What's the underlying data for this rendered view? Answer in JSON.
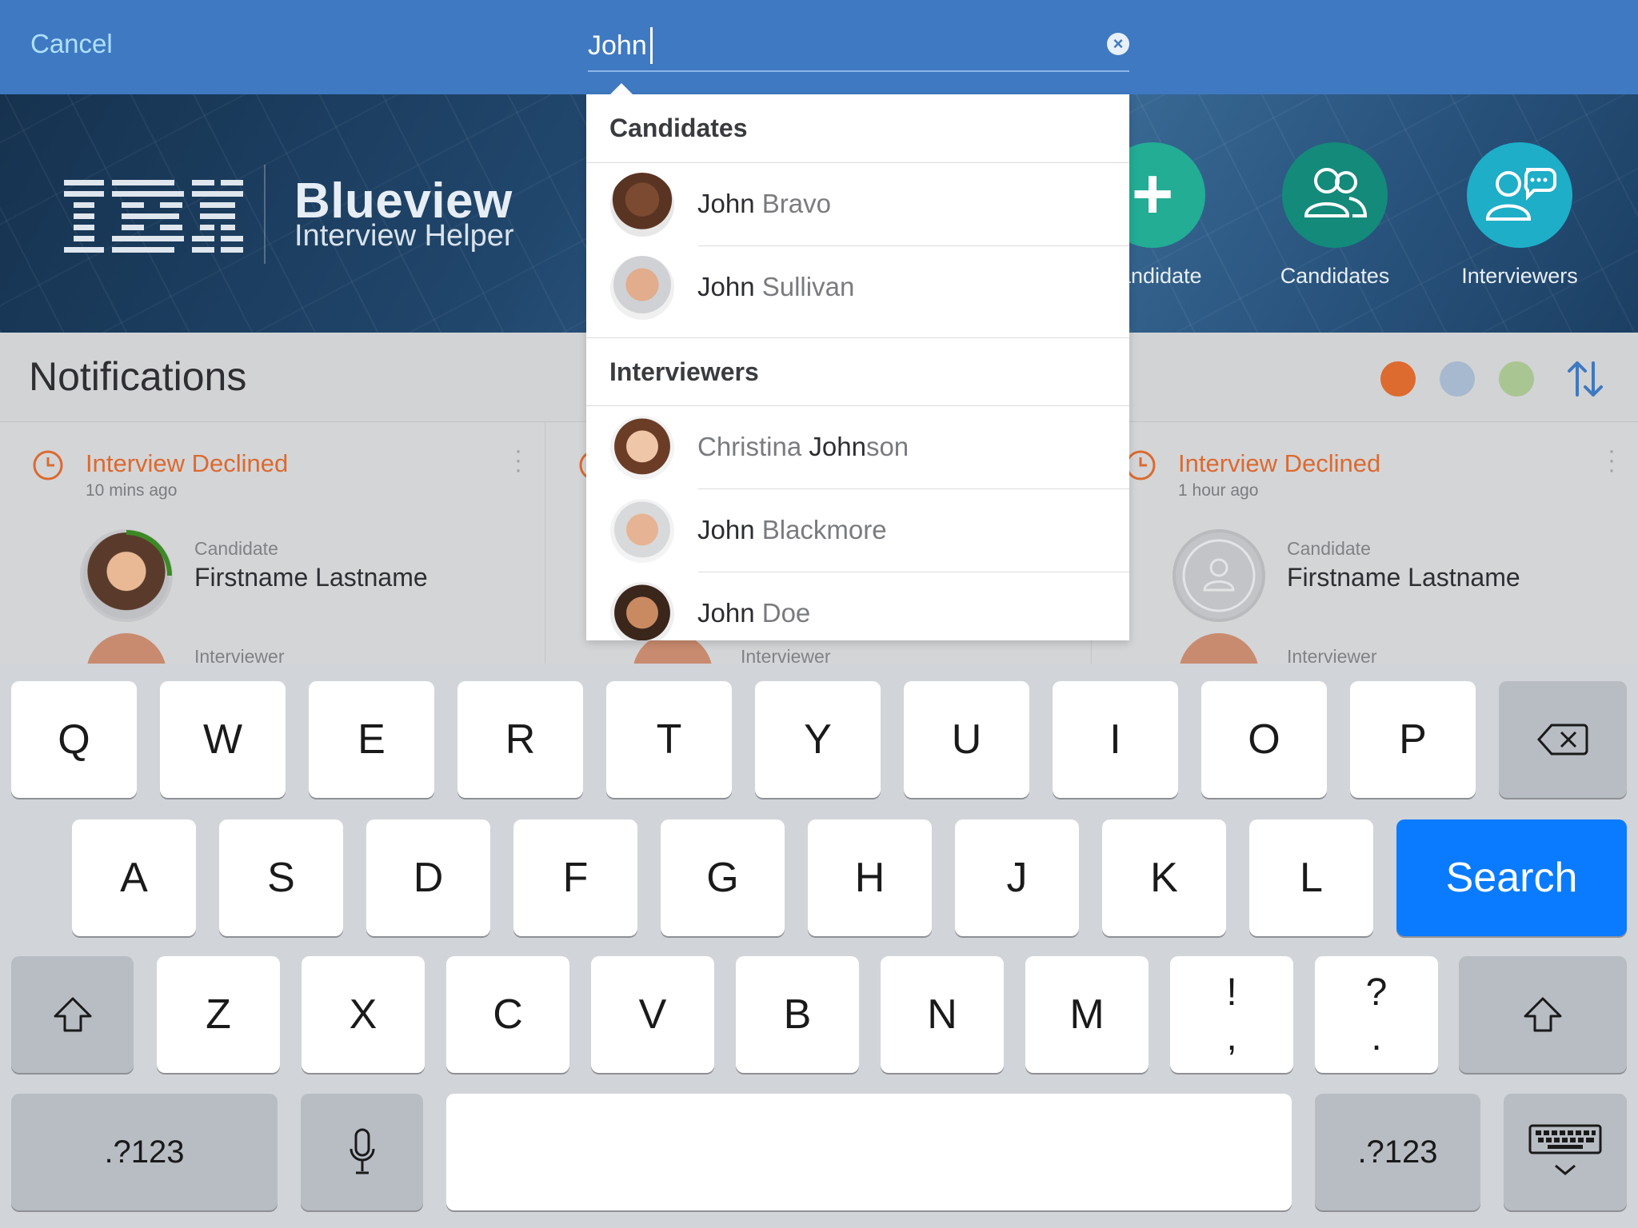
{
  "search": {
    "cancel_label": "Cancel",
    "query": "John"
  },
  "hero": {
    "logo_text": "IBM",
    "app_title": "Blueview",
    "app_subtitle": "Interview Helper",
    "actions": [
      {
        "label": "Candidate",
        "icon": "add-icon"
      },
      {
        "label": "Candidates",
        "icon": "people-icon"
      },
      {
        "label": "Interviewers",
        "icon": "people-chat-icon"
      }
    ]
  },
  "notifications": {
    "title": "Notifications",
    "filters": [
      {
        "color": "#dd6a2e"
      },
      {
        "color": "#a7b9cf"
      },
      {
        "color": "#a9c592"
      }
    ],
    "cards": [
      {
        "status": "Interview Declined",
        "time": "10 mins ago",
        "role": "Candidate",
        "name": "Firstname Lastname",
        "role2": "Interviewer"
      },
      {
        "role2": "Interviewer"
      },
      {
        "status": "Interview Declined",
        "time": "1 hour ago",
        "role": "Candidate",
        "name": "Firstname Lastname",
        "role2": "Interviewer"
      }
    ]
  },
  "dropdown": {
    "candidates_header": "Candidates",
    "interviewers_header": "Interviewers",
    "candidates": [
      {
        "first": "John",
        "last": " Bravo"
      },
      {
        "first": "John",
        "last": " Sullivan"
      }
    ],
    "interviewers": [
      {
        "pre": "Christina ",
        "match": "John",
        "post": "son"
      },
      {
        "pre": "",
        "match": "John",
        "post": " Blackmore"
      },
      {
        "pre": "",
        "match": "John",
        "post": " Doe"
      }
    ]
  },
  "keyboard": {
    "row1": [
      "Q",
      "W",
      "E",
      "R",
      "T",
      "Y",
      "U",
      "I",
      "O",
      "P"
    ],
    "row2": [
      "A",
      "S",
      "D",
      "F",
      "G",
      "H",
      "J",
      "K",
      "L"
    ],
    "row3": [
      "Z",
      "X",
      "C",
      "V",
      "B",
      "N",
      "M"
    ],
    "punct1": {
      "top": "!",
      "bottom": ","
    },
    "punct2": {
      "top": "?",
      "bottom": "."
    },
    "search_label": "Search",
    "numbers_label": ".?123"
  },
  "colors": {
    "topbar": "#3f79c1",
    "accent_orange": "#db6a30",
    "search_key": "#0a7bff"
  }
}
